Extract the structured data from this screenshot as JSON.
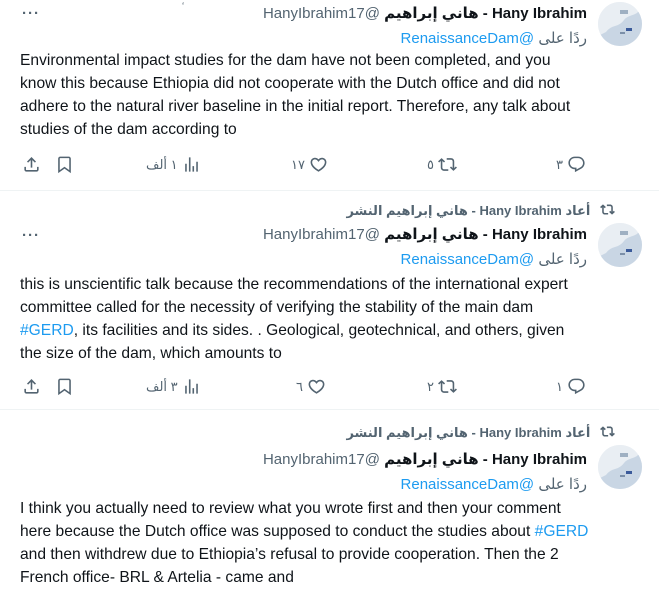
{
  "ui": {
    "more_label": "···",
    "reply_to_prefix": "ردًا على"
  },
  "tweets": [
    {
      "display_name": "Hany Ibrahim - هاني إبراهيم",
      "handle": "@HanyIbrahim17",
      "small_mark": "ٔ",
      "reply_to": "@RenaissanceDam",
      "body": "Environmental impact studies for the dam have not been completed, and you know this because Ethiopia did not cooperate with the Dutch office and did not adhere to the natural river baseline in the initial report. Therefore, any talk about studies of the dam according to",
      "counts": {
        "reply": "٣",
        "retweet": "٥",
        "like": "١٧",
        "views": "١ ألف"
      }
    },
    {
      "retweeted_by": "أعاد Hany Ibrahim - هاني إبراهيم النشر",
      "display_name": "Hany Ibrahim - هاني إبراهيم",
      "handle": "@HanyIbrahim17",
      "reply_to": "@RenaissanceDam",
      "body_before": "this is unscientific talk because the recommendations of the international expert committee called for the necessity of verifying the stability of the main dam ",
      "hashtag": "#GERD",
      "body_after": ", its facilities and its sides. . Geological, geotechnical, and others, given the size of the dam, which amounts to",
      "counts": {
        "reply": "١",
        "retweet": "٢",
        "like": "٦",
        "views": "٣ ألف"
      }
    },
    {
      "retweeted_by": "أعاد Hany Ibrahim - هاني إبراهيم النشر",
      "display_name": "Hany Ibrahim - هاني إبراهيم",
      "handle": "@HanyIbrahim17",
      "reply_to": "@RenaissanceDam",
      "body_before": "I think you actually need to review what you wrote first and then your comment here because the Dutch office was supposed to conduct the studies about ",
      "hashtag": "#GERD",
      "body_after": " and then withdrew due to Ethiopia’s refusal to provide cooperation. Then the  2 French office- BRL & Artelia - came and"
    }
  ]
}
